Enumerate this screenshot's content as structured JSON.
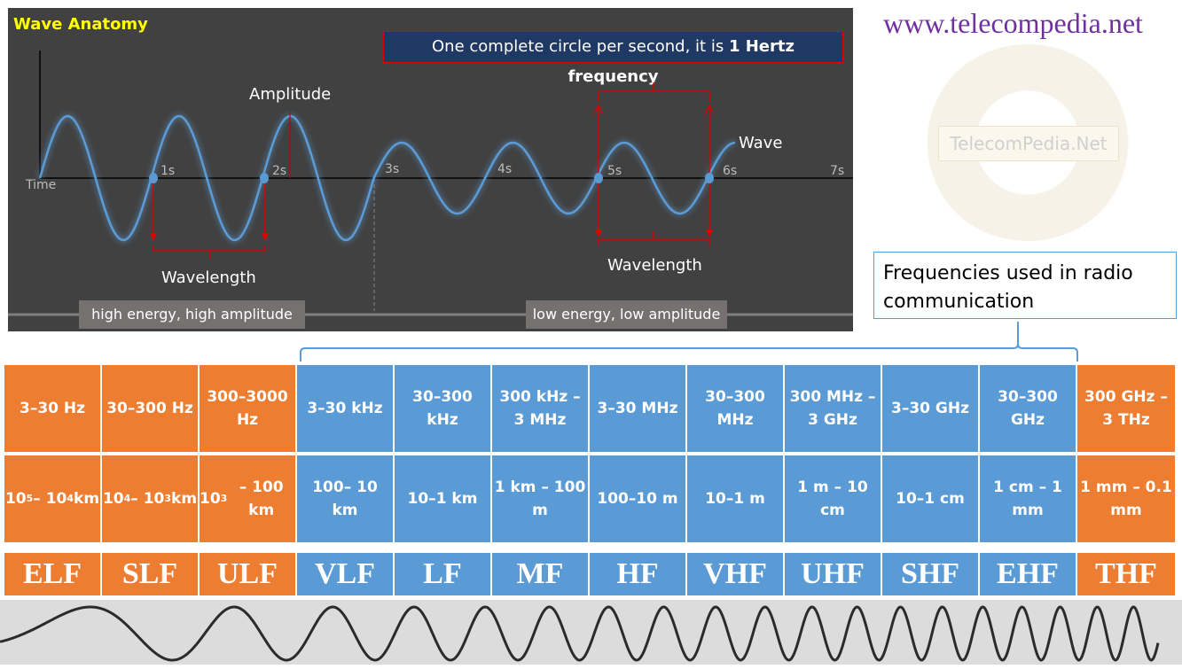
{
  "wave_anatomy": {
    "title": "Wave Anatomy",
    "frequency_note_prefix": "One complete circle per second, it is ",
    "frequency_note_bold": "1 Hertz frequency",
    "amplitude_label": "Amplitude",
    "wave_label": "Wave",
    "time_label": "Time",
    "time_ticks": [
      "1s",
      "2s",
      "3s",
      "4s",
      "5s",
      "6s",
      "7s"
    ],
    "wavelength_label_left": "Wavelength",
    "wavelength_label_right": "Wavelength",
    "energy_left": "high energy, high amplitude",
    "energy_right": "low energy, low amplitude"
  },
  "site": {
    "url": "www.telecompedia.net",
    "watermark": "TelecomPedia.Net"
  },
  "radio_note": "Frequencies used in radio communication",
  "spectrum": {
    "colors": {
      "non_radio": "#ed7d31",
      "radio": "#5b9bd5"
    },
    "bands": [
      {
        "name": "ELF",
        "frequency": "3–30 Hz",
        "wavelength": "10^5– 10^4 km",
        "radio": false
      },
      {
        "name": "SLF",
        "frequency": "30–300 Hz",
        "wavelength": "10^4– 10^3 km",
        "radio": false
      },
      {
        "name": "ULF",
        "frequency": "300–3000 Hz",
        "wavelength": "10^3– 100 km",
        "radio": false
      },
      {
        "name": "VLF",
        "frequency": "3–30 kHz",
        "wavelength": "100– 10 km",
        "radio": true
      },
      {
        "name": "LF",
        "frequency": "30–300 kHz",
        "wavelength": "10–1 km",
        "radio": true
      },
      {
        "name": "MF",
        "frequency": "300 kHz – 3 MHz",
        "wavelength": "1 km – 100 m",
        "radio": true
      },
      {
        "name": "HF",
        "frequency": "3–30 MHz",
        "wavelength": "100–10 m",
        "radio": true
      },
      {
        "name": "VHF",
        "frequency": "30–300 MHz",
        "wavelength": "10–1 m",
        "radio": true
      },
      {
        "name": "UHF",
        "frequency": "300 MHz – 3 GHz",
        "wavelength": "1 m – 10 cm",
        "radio": true
      },
      {
        "name": "SHF",
        "frequency": "3–30 GHz",
        "wavelength": "10–1 cm",
        "radio": true
      },
      {
        "name": "EHF",
        "frequency": "30–300 GHz",
        "wavelength": "1 cm – 1 mm",
        "radio": true
      },
      {
        "name": "THF",
        "frequency": "300 GHz – 3 THz",
        "wavelength": "1 mm – 0.1 mm",
        "radio": false
      }
    ]
  }
}
